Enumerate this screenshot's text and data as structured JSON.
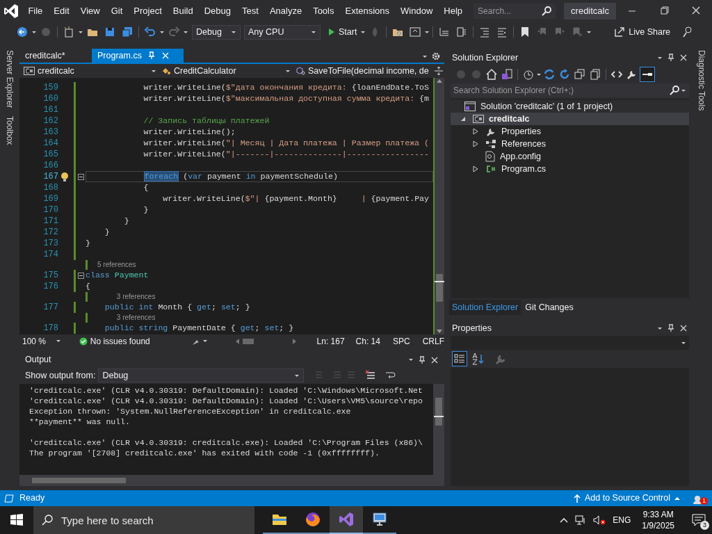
{
  "menu": [
    "File",
    "Edit",
    "View",
    "Git",
    "Project",
    "Build",
    "Debug",
    "Test",
    "Analyze",
    "Tools",
    "Extensions",
    "Window",
    "Help"
  ],
  "search": {
    "placeholder": "Search..."
  },
  "solution_name": "creditcalc",
  "toolbar": {
    "configuration": "Debug",
    "platform": "Any CPU",
    "start": "Start",
    "live_share": "Live Share"
  },
  "left_strip": [
    "Server Explorer",
    "Toolbox"
  ],
  "right_strip": [
    "Diagnostic Tools"
  ],
  "editor": {
    "tabs": [
      {
        "label": "creditcalc*",
        "selected": false
      },
      {
        "label": "Program.cs",
        "selected": true
      }
    ],
    "nav": [
      "creditcalc",
      "CreditCalculator",
      "SaveToFile(decimal income, de"
    ],
    "lines": [
      {
        "number": "159",
        "tokens": [
          {
            "kind": "plain",
            "text": "            writer.WriteLine("
          },
          {
            "kind": "str",
            "text": "$\"дата окончания кредита: "
          },
          {
            "kind": "plain",
            "text": "{loanEndDate.ToS"
          }
        ]
      },
      {
        "number": "160",
        "tokens": [
          {
            "kind": "plain",
            "text": "            writer.WriteLine("
          },
          {
            "kind": "str",
            "text": "$\"максимальная доступная сумма кредита: "
          },
          {
            "kind": "plain",
            "text": "{m"
          }
        ]
      },
      {
        "number": "161"
      },
      {
        "number": "162",
        "tokens": [
          {
            "kind": "comment",
            "text": "            // Запись таблицы платежей"
          }
        ]
      },
      {
        "number": "163",
        "tokens": [
          {
            "kind": "plain",
            "text": "            writer.WriteLine();"
          }
        ]
      },
      {
        "number": "164",
        "tokens": [
          {
            "kind": "plain",
            "text": "            writer.WriteLine("
          },
          {
            "kind": "str",
            "text": "\"| Месяц | Дата платежа | Размер платежа ("
          }
        ]
      },
      {
        "number": "165",
        "tokens": [
          {
            "kind": "plain",
            "text": "            writer.WriteLine("
          },
          {
            "kind": "str",
            "text": "\"|-------|--------------|-----------------"
          }
        ]
      },
      {
        "number": "166"
      },
      {
        "number": "167",
        "current": true,
        "fold": true,
        "lightbulb": true,
        "tokens": [
          {
            "kind": "match",
            "text": "            foreach"
          },
          {
            "kind": "plain",
            "text": " ("
          },
          {
            "kind": "kw",
            "text": "var"
          },
          {
            "kind": "plain",
            "text": " payment "
          },
          {
            "kind": "kw",
            "text": "in"
          },
          {
            "kind": "plain",
            "text": " paymentSchedule)"
          }
        ]
      },
      {
        "number": "168",
        "tokens": [
          {
            "kind": "plain",
            "text": "            {"
          }
        ]
      },
      {
        "number": "169",
        "tokens": [
          {
            "kind": "plain",
            "text": "                writer.WriteLine("
          },
          {
            "kind": "str",
            "text": "$\"| "
          },
          {
            "kind": "plain",
            "text": "{payment.Month}"
          },
          {
            "kind": "str",
            "text": "     | "
          },
          {
            "kind": "plain",
            "text": "{payment.Pay"
          }
        ]
      },
      {
        "number": "170",
        "tokens": [
          {
            "kind": "plain",
            "text": "            }"
          }
        ]
      },
      {
        "number": "171",
        "tokens": [
          {
            "kind": "plain",
            "text": "        }"
          }
        ]
      },
      {
        "number": "172",
        "tokens": [
          {
            "kind": "plain",
            "text": "    }"
          }
        ]
      },
      {
        "number": "173",
        "tokens": [
          {
            "kind": "plain",
            "text": "}"
          }
        ]
      },
      {
        "number": "174"
      },
      {
        "number": "175",
        "fold": true,
        "references": "5 references",
        "tokens": [
          {
            "kind": "kw",
            "text": "class"
          },
          {
            "kind": "type",
            "text": " Payment"
          }
        ]
      },
      {
        "number": "176",
        "tokens": [
          {
            "kind": "plain",
            "text": "{"
          }
        ]
      },
      {
        "number": "177",
        "references": "3 references",
        "tokens": [
          {
            "kind": "kw",
            "text": "    public"
          },
          {
            "kind": "kw",
            "text": " int"
          },
          {
            "kind": "plain",
            "text": " Month { "
          },
          {
            "kind": "kw",
            "text": "get"
          },
          {
            "kind": "plain",
            "text": "; "
          },
          {
            "kind": "kw",
            "text": "set"
          },
          {
            "kind": "plain",
            "text": "; }"
          }
        ]
      },
      {
        "number": "178",
        "references": "3 references",
        "tokens": [
          {
            "kind": "kw",
            "text": "    public"
          },
          {
            "kind": "kw",
            "text": " string"
          },
          {
            "kind": "plain",
            "text": " PaymentDate { "
          },
          {
            "kind": "kw",
            "text": "get"
          },
          {
            "kind": "plain",
            "text": "; "
          },
          {
            "kind": "kw",
            "text": "set"
          },
          {
            "kind": "plain",
            "text": "; }"
          }
        ]
      }
    ],
    "zoom": "100 %",
    "issues": "No issues found",
    "line": "Ln: 167",
    "column": "Ch: 14",
    "whitespace": "SPC",
    "line_endings": "CRLF"
  },
  "output": {
    "title": "Output",
    "source_label": "Show output from:",
    "source": "Debug",
    "blocks": [
      [
        "'creditcalc.exe' (CLR v4.0.30319: DefaultDomain): Loaded 'C:\\Windows\\Microsoft.Net",
        "'creditcalc.exe' (CLR v4.0.30319: DefaultDomain): Loaded 'C:\\Users\\VM5\\source\\repo",
        "Exception thrown: 'System.NullReferenceException' in creditcalc.exe",
        "**payment** was null."
      ],
      [
        "'creditcalc.exe' (CLR v4.0.30319: creditcalc.exe): Loaded 'C:\\Program Files (x86)\\",
        "The program '[2708] creditcalc.exe' has exited with code -1 (0xffffffff)."
      ]
    ]
  },
  "solution_explorer": {
    "title": "Solution Explorer",
    "search_placeholder": "Search Solution Explorer (Ctrl+;)",
    "tree": [
      {
        "label": "Solution 'creditcalc' (1 of 1 project)",
        "kind": "solution",
        "selected": false,
        "children": [
          {
            "label": "creditcalc",
            "kind": "project",
            "selected": true,
            "expanded": true,
            "children": [
              {
                "label": "Properties",
                "kind": "properties",
                "selected": false,
                "expanded": false
              },
              {
                "label": "References",
                "kind": "references",
                "selected": false,
                "expanded": false
              },
              {
                "label": "App.config",
                "kind": "config",
                "selected": false
              },
              {
                "label": "Program.cs",
                "kind": "csharp",
                "selected": false,
                "expanded": false
              }
            ]
          }
        ]
      }
    ],
    "tabs": [
      {
        "label": "Solution Explorer",
        "selected": true
      },
      {
        "label": "Git Changes",
        "selected": false
      }
    ]
  },
  "properties": {
    "title": "Properties"
  },
  "status_bar": {
    "text": "Ready",
    "source_control": "Add to Source Control",
    "notifications": "1"
  },
  "taskbar": {
    "search_placeholder": "Type here to search",
    "language": "ENG",
    "time": "9:33 AM",
    "date": "1/9/2025",
    "notifications": "3"
  }
}
